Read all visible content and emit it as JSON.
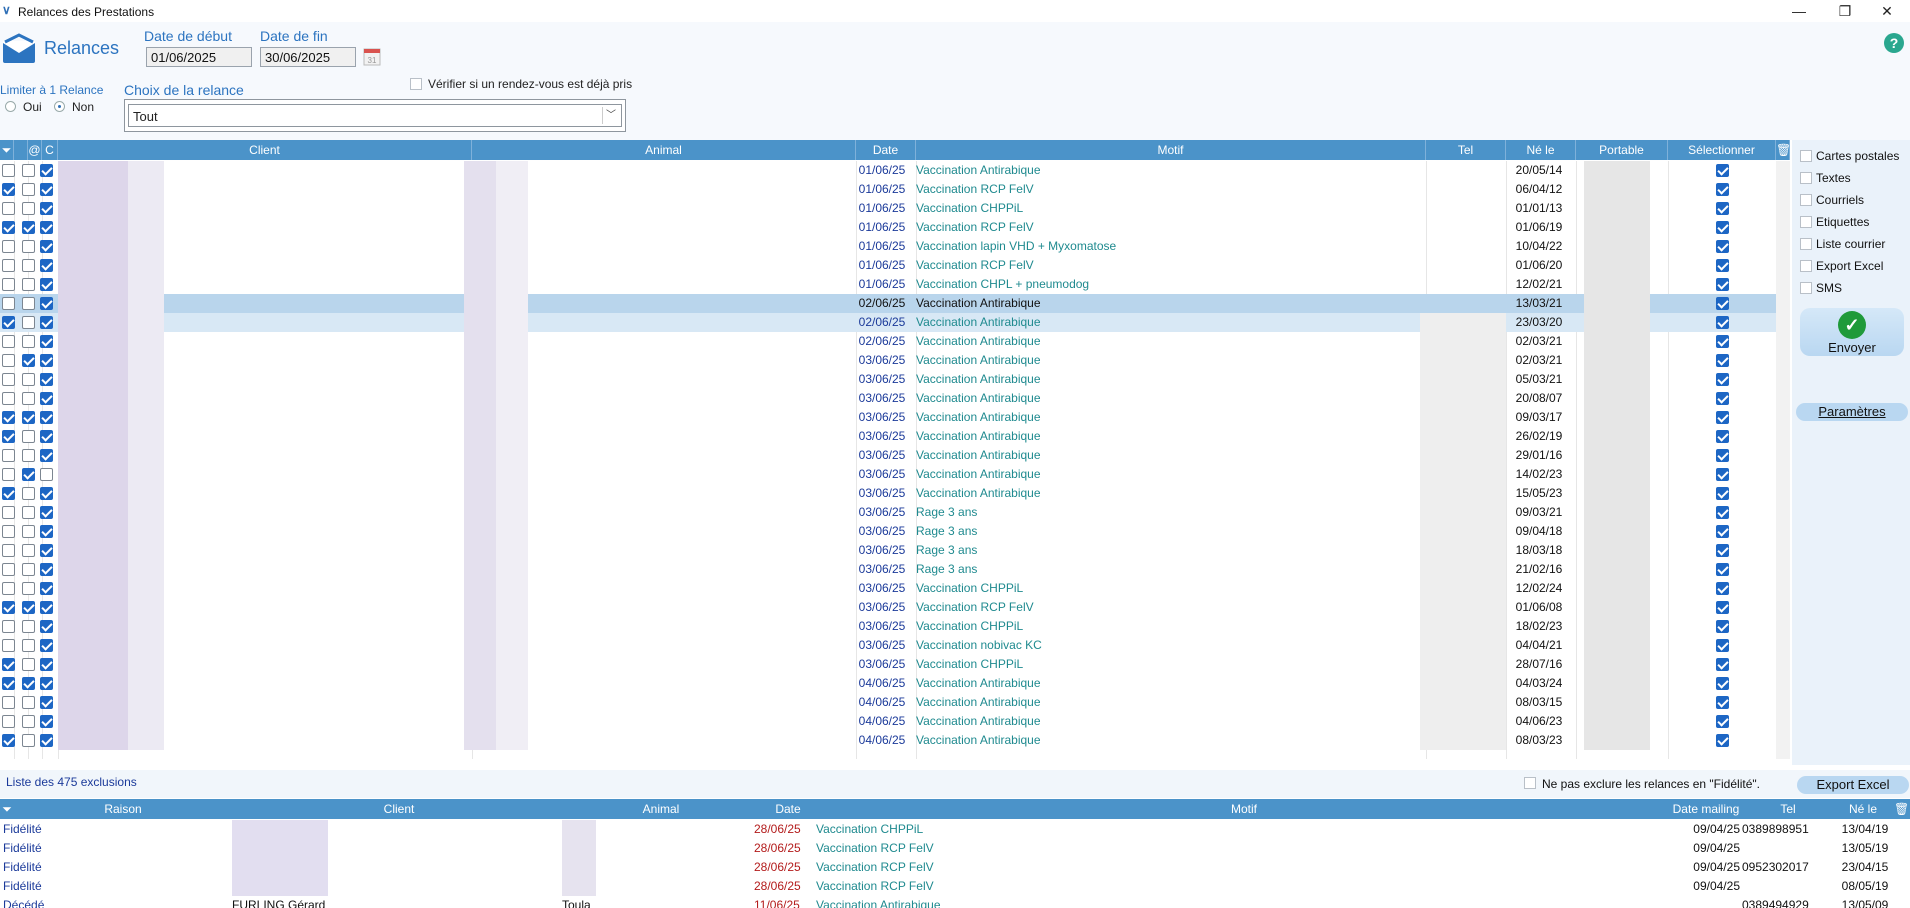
{
  "window": {
    "title": "Relances des Prestations",
    "icon": "app-logo-icon",
    "min": "—",
    "max": "❐",
    "close": "✕"
  },
  "header": {
    "app_name": "Relances",
    "date_debut_label": "Date de début",
    "date_fin_label": "Date de fin",
    "date_debut": "01/06/2025",
    "date_fin": "30/06/2025",
    "calendar_label": "31",
    "help": "?",
    "limiter_label": "Limiter à 1 Relance",
    "oui": "Oui",
    "non": "Non",
    "choix_label": "Choix de la relance",
    "choix_value": "Tout",
    "verifier_label": "Vérifier si un rendez-vous est déjà pris"
  },
  "grid": {
    "headers": {
      "at": "@",
      "c": "C",
      "client": "Client",
      "animal": "Animal",
      "date": "Date",
      "motif": "Motif",
      "tel": "Tel",
      "ne": "Né le",
      "portable": "Portable",
      "selectionner": "Sélectionner"
    },
    "rows": [
      {
        "c1": false,
        "c2": false,
        "c3": true,
        "date": "01/06/25",
        "motif": "Vaccination Antirabique",
        "ne": "20/05/14"
      },
      {
        "c1": true,
        "c2": false,
        "c3": true,
        "date": "01/06/25",
        "motif": "Vaccination RCP FelV",
        "ne": "06/04/12"
      },
      {
        "c1": false,
        "c2": false,
        "c3": true,
        "date": "01/06/25",
        "motif": "Vaccination CHPPiL",
        "ne": "01/01/13"
      },
      {
        "c1": true,
        "c2": true,
        "c3": true,
        "date": "01/06/25",
        "motif": "Vaccination RCP FelV",
        "ne": "01/06/19"
      },
      {
        "c1": false,
        "c2": false,
        "c3": true,
        "date": "01/06/25",
        "motif": "Vaccination lapin VHD + Myxomatose",
        "ne": "10/04/22"
      },
      {
        "c1": false,
        "c2": false,
        "c3": true,
        "date": "01/06/25",
        "motif": "Vaccination RCP FelV",
        "ne": "01/06/20"
      },
      {
        "c1": false,
        "c2": false,
        "c3": true,
        "date": "01/06/25",
        "motif": "Vaccination CHPL + pneumodog",
        "ne": "12/02/21"
      },
      {
        "c1": false,
        "c2": false,
        "c3": true,
        "date": "02/06/25",
        "motif": "Vaccination Antirabique",
        "ne": "13/03/21"
      },
      {
        "c1": true,
        "c2": false,
        "c3": true,
        "date": "02/06/25",
        "motif": "Vaccination Antirabique",
        "ne": "23/03/20"
      },
      {
        "c1": false,
        "c2": false,
        "c3": true,
        "date": "02/06/25",
        "motif": "Vaccination Antirabique",
        "ne": "02/03/21"
      },
      {
        "c1": false,
        "c2": true,
        "c3": true,
        "date": "03/06/25",
        "motif": "Vaccination Antirabique",
        "ne": "02/03/21"
      },
      {
        "c1": false,
        "c2": false,
        "c3": true,
        "date": "03/06/25",
        "motif": "Vaccination Antirabique",
        "ne": "05/03/21"
      },
      {
        "c1": false,
        "c2": false,
        "c3": true,
        "date": "03/06/25",
        "motif": "Vaccination Antirabique",
        "ne": "20/08/07"
      },
      {
        "c1": true,
        "c2": true,
        "c3": true,
        "date": "03/06/25",
        "motif": "Vaccination Antirabique",
        "ne": "09/03/17"
      },
      {
        "c1": true,
        "c2": false,
        "c3": true,
        "date": "03/06/25",
        "motif": "Vaccination Antirabique",
        "ne": "26/02/19"
      },
      {
        "c1": false,
        "c2": false,
        "c3": true,
        "date": "03/06/25",
        "motif": "Vaccination Antirabique",
        "ne": "29/01/16"
      },
      {
        "c1": false,
        "c2": true,
        "c3": false,
        "date": "03/06/25",
        "motif": "Vaccination Antirabique",
        "ne": "14/02/23"
      },
      {
        "c1": true,
        "c2": false,
        "c3": true,
        "date": "03/06/25",
        "motif": "Vaccination Antirabique",
        "ne": "15/05/23"
      },
      {
        "c1": false,
        "c2": false,
        "c3": true,
        "date": "03/06/25",
        "motif": "Rage 3 ans",
        "ne": "09/03/21"
      },
      {
        "c1": false,
        "c2": false,
        "c3": true,
        "date": "03/06/25",
        "motif": "Rage 3 ans",
        "ne": "09/04/18"
      },
      {
        "c1": false,
        "c2": false,
        "c3": true,
        "date": "03/06/25",
        "motif": "Rage 3 ans",
        "ne": "18/03/18"
      },
      {
        "c1": false,
        "c2": false,
        "c3": true,
        "date": "03/06/25",
        "motif": "Rage 3 ans",
        "ne": "21/02/16"
      },
      {
        "c1": false,
        "c2": false,
        "c3": true,
        "date": "03/06/25",
        "motif": "Vaccination CHPPiL",
        "ne": "12/02/24"
      },
      {
        "c1": true,
        "c2": true,
        "c3": true,
        "date": "03/06/25",
        "motif": "Vaccination RCP FelV",
        "ne": "01/06/08"
      },
      {
        "c1": false,
        "c2": false,
        "c3": true,
        "date": "03/06/25",
        "motif": "Vaccination CHPPiL",
        "ne": "18/02/23"
      },
      {
        "c1": false,
        "c2": false,
        "c3": true,
        "date": "03/06/25",
        "motif": "Vaccination nobivac KC",
        "ne": "04/04/21"
      },
      {
        "c1": true,
        "c2": false,
        "c3": true,
        "date": "03/06/25",
        "motif": "Vaccination CHPPiL",
        "ne": "28/07/16"
      },
      {
        "c1": true,
        "c2": true,
        "c3": true,
        "date": "04/06/25",
        "motif": "Vaccination Antirabique",
        "ne": "04/03/24"
      },
      {
        "c1": false,
        "c2": false,
        "c3": true,
        "date": "04/06/25",
        "motif": "Vaccination Antirabique",
        "ne": "08/03/15"
      },
      {
        "c1": false,
        "c2": false,
        "c3": true,
        "date": "04/06/25",
        "motif": "Vaccination Antirabique",
        "ne": "04/06/23"
      },
      {
        "c1": true,
        "c2": false,
        "c3": true,
        "date": "04/06/25",
        "motif": "Vaccination Antirabique",
        "ne": "08/03/23"
      }
    ]
  },
  "side": {
    "options": [
      "Cartes postales",
      "Textes",
      "Courriels",
      "Etiquettes",
      "Liste courrier",
      "Export Excel",
      "SMS"
    ],
    "envoyer": "Envoyer",
    "ok": "✓",
    "parametres": "Paramètres"
  },
  "exclusions": {
    "label": "Liste des 475 exclusions",
    "fidelite_label": "Ne pas exclure les relances en \"Fidélité\".",
    "export": "Export Excel",
    "headers": {
      "raison": "Raison",
      "client": "Client",
      "animal": "Animal",
      "date": "Date",
      "motif": "Motif",
      "mailing": "Date mailing",
      "tel": "Tel",
      "ne": "Né le"
    },
    "rows": [
      {
        "raison": "Fidélité",
        "client": "",
        "animal": "",
        "date": "28/06/25",
        "motif": "Vaccination CHPPiL",
        "mailing": "09/04/25",
        "tel": "0389898951",
        "ne": "13/04/19"
      },
      {
        "raison": "Fidélité",
        "client": "",
        "animal": "",
        "date": "28/06/25",
        "motif": "Vaccination RCP FelV",
        "mailing": "09/04/25",
        "tel": "",
        "ne": "13/05/19"
      },
      {
        "raison": "Fidélité",
        "client": "",
        "animal": "",
        "date": "28/06/25",
        "motif": "Vaccination RCP FelV",
        "mailing": "09/04/25",
        "tel": "0952302017",
        "ne": "23/04/15"
      },
      {
        "raison": "Fidélité",
        "client": "",
        "animal": "",
        "date": "28/06/25",
        "motif": "Vaccination RCP FelV",
        "mailing": "09/04/25",
        "tel": "",
        "ne": "08/05/19"
      },
      {
        "raison": "Décédé",
        "client": "FURLING Gérard",
        "animal": "Toula",
        "date": "11/06/25",
        "motif": "Vaccination Antirabique",
        "mailing": "",
        "tel": "0389494929",
        "ne": "13/05/09"
      }
    ]
  }
}
